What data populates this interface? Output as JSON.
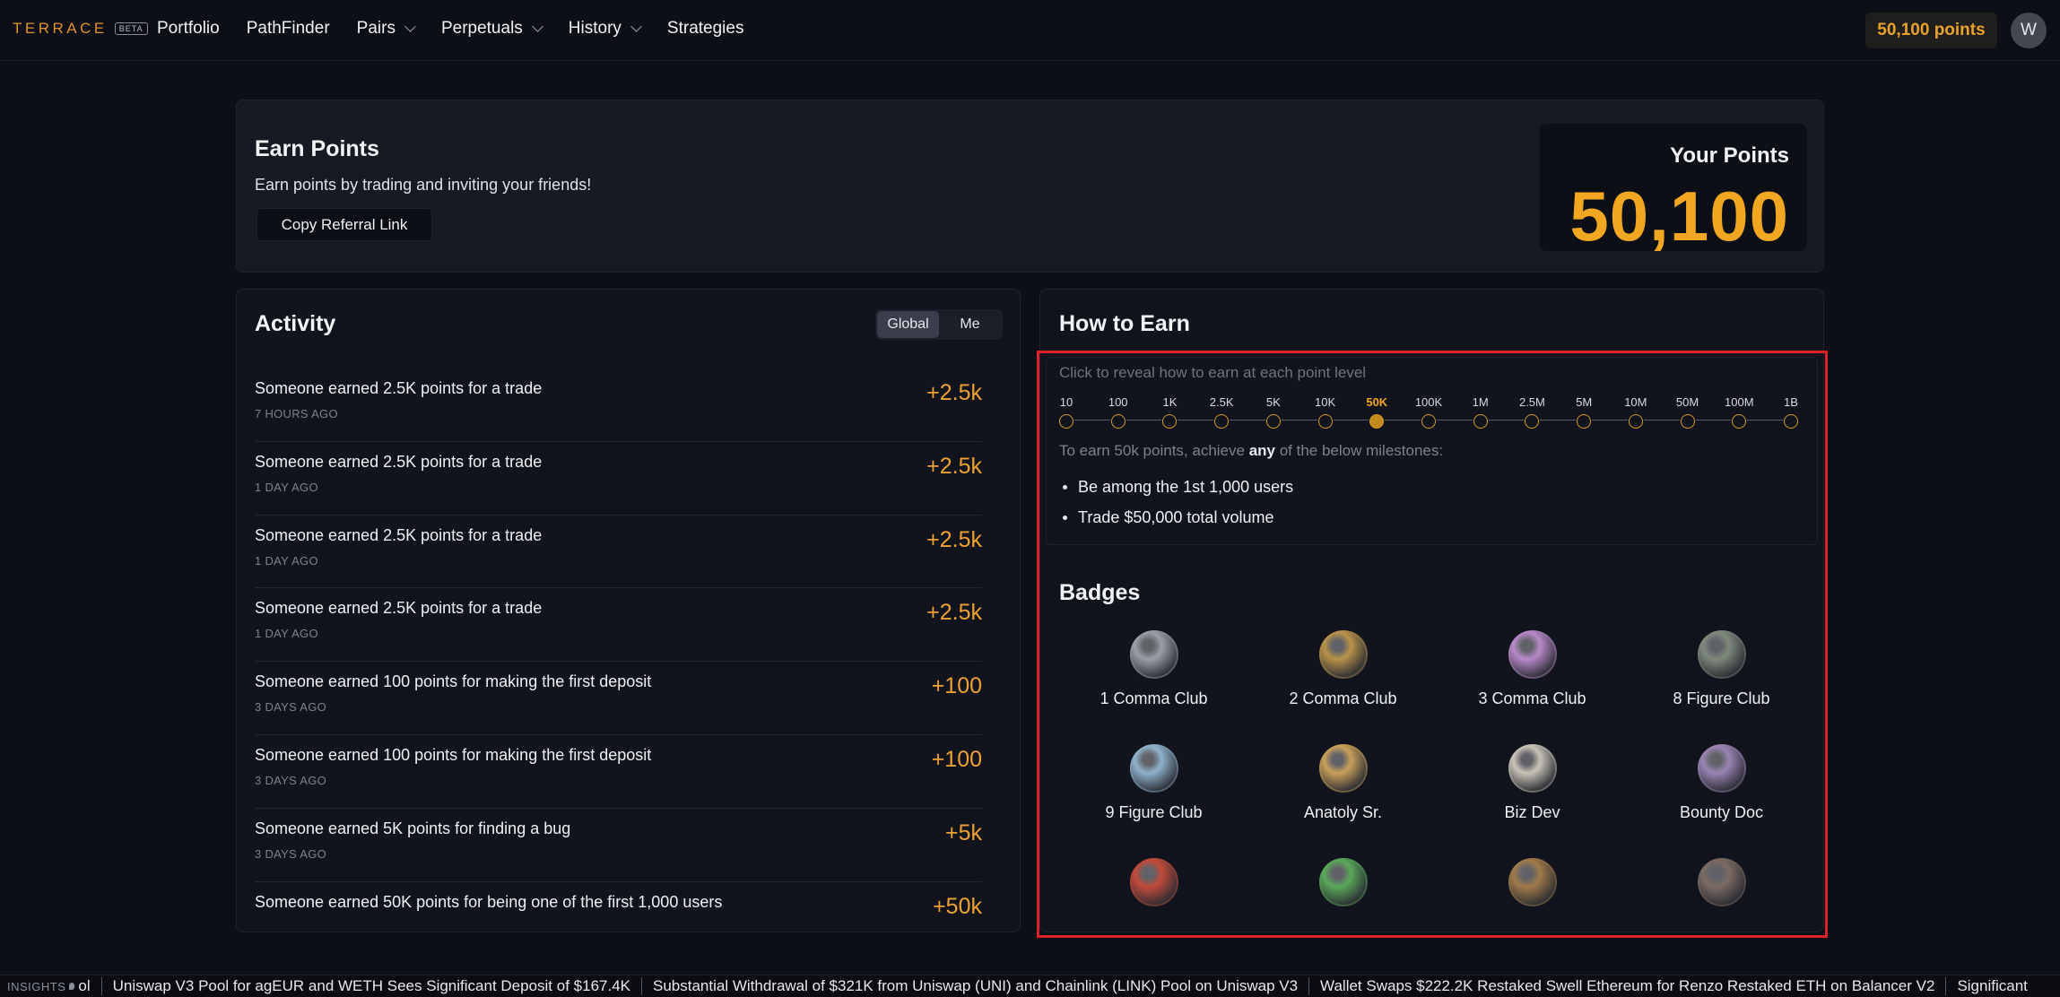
{
  "nav": {
    "logo": "TERRACE",
    "beta": "BETA",
    "links": [
      {
        "label": "Portfolio",
        "dropdown": false
      },
      {
        "label": "PathFinder",
        "dropdown": false
      },
      {
        "label": "Pairs",
        "dropdown": true
      },
      {
        "label": "Perpetuals",
        "dropdown": true
      },
      {
        "label": "History",
        "dropdown": true
      },
      {
        "label": "Strategies",
        "dropdown": false
      }
    ],
    "points": "50,100 points",
    "avatar": "W"
  },
  "earn": {
    "title": "Earn Points",
    "subtitle": "Earn points by trading and inviting your friends!",
    "copy_button": "Copy Referral Link",
    "your_points_label": "Your Points",
    "your_points_value": "50,100"
  },
  "activity": {
    "title": "Activity",
    "tabs": [
      "Global",
      "Me"
    ],
    "active_tab": "Global",
    "items": [
      {
        "text": "Someone earned 2.5K points for a trade",
        "time": "7 HOURS AGO",
        "value": "+2.5k"
      },
      {
        "text": "Someone earned 2.5K points for a trade",
        "time": "1 DAY AGO",
        "value": "+2.5k"
      },
      {
        "text": "Someone earned 2.5K points for a trade",
        "time": "1 DAY AGO",
        "value": "+2.5k"
      },
      {
        "text": "Someone earned 2.5K points for a trade",
        "time": "1 DAY AGO",
        "value": "+2.5k"
      },
      {
        "text": "Someone earned 100 points for making the first deposit",
        "time": "3 DAYS AGO",
        "value": "+100"
      },
      {
        "text": "Someone earned 100 points for making the first deposit",
        "time": "3 DAYS AGO",
        "value": "+100"
      },
      {
        "text": "Someone earned 5K points for finding a bug",
        "time": "3 DAYS AGO",
        "value": "+5k"
      },
      {
        "text": "Someone earned 50K points for being one of the first 1,000 users",
        "time": "",
        "value": "+50k"
      }
    ]
  },
  "how_to_earn": {
    "title": "How to Earn",
    "hint": "Click to reveal how to earn at each point level",
    "levels": [
      "10",
      "100",
      "1K",
      "2.5K",
      "5K",
      "10K",
      "50K",
      "100K",
      "1M",
      "2.5M",
      "5M",
      "10M",
      "50M",
      "100M",
      "1B"
    ],
    "active_level": "50K",
    "desc_prefix": "To earn 50k points, achieve ",
    "desc_emphasis": "any",
    "desc_suffix": " of the below milestones:",
    "milestones": [
      "Be among the 1st 1,000 users",
      "Trade $50,000 total volume"
    ]
  },
  "badges": {
    "title": "Badges",
    "items": [
      {
        "name": "1 Comma Club",
        "icon": "silver-shield-icon",
        "color": "#9aa0a8"
      },
      {
        "name": "2 Comma Club",
        "icon": "gold-shield-icon",
        "color": "#b8924a"
      },
      {
        "name": "3 Comma Club",
        "icon": "purple-gem-icon",
        "color": "#b889c9"
      },
      {
        "name": "8 Figure Club",
        "icon": "eight-emblem-icon",
        "color": "#7f8a7c"
      },
      {
        "name": "9 Figure Club",
        "icon": "winged-badge-icon",
        "color": "#8fb2cc"
      },
      {
        "name": "Anatoly Sr.",
        "icon": "gold-coin-icon",
        "color": "#c9a05a"
      },
      {
        "name": "Biz Dev",
        "icon": "id-card-icon",
        "color": "#c9c4b8"
      },
      {
        "name": "Bounty Doc",
        "icon": "scroll-badge-icon",
        "color": "#9a84b3"
      },
      {
        "name": "",
        "icon": "red-cube-icon",
        "color": "#c24a3a"
      },
      {
        "name": "",
        "icon": "green-crest-icon",
        "color": "#5aa85a"
      },
      {
        "name": "",
        "icon": "bronze-portrait-icon",
        "color": "#a17a4a"
      },
      {
        "name": "",
        "icon": "dark-emblem-icon",
        "color": "#7a6a62"
      }
    ]
  },
  "ticker": {
    "label": "INSIGHTS",
    "lead": "ol",
    "items": [
      "Uniswap V3 Pool for agEUR and WETH Sees Significant Deposit of $167.4K",
      "Substantial Withdrawal of $321K from Uniswap (UNI) and Chainlink (LINK) Pool on Uniswap V3",
      "Wallet Swaps $222.2K Restaked Swell Ethereum for Renzo Restaked ETH on Balancer V2",
      "Significant"
    ]
  },
  "colors": {
    "accent": "#f2a722",
    "background": "#0d0f17",
    "highlight": "#dc2128"
  }
}
